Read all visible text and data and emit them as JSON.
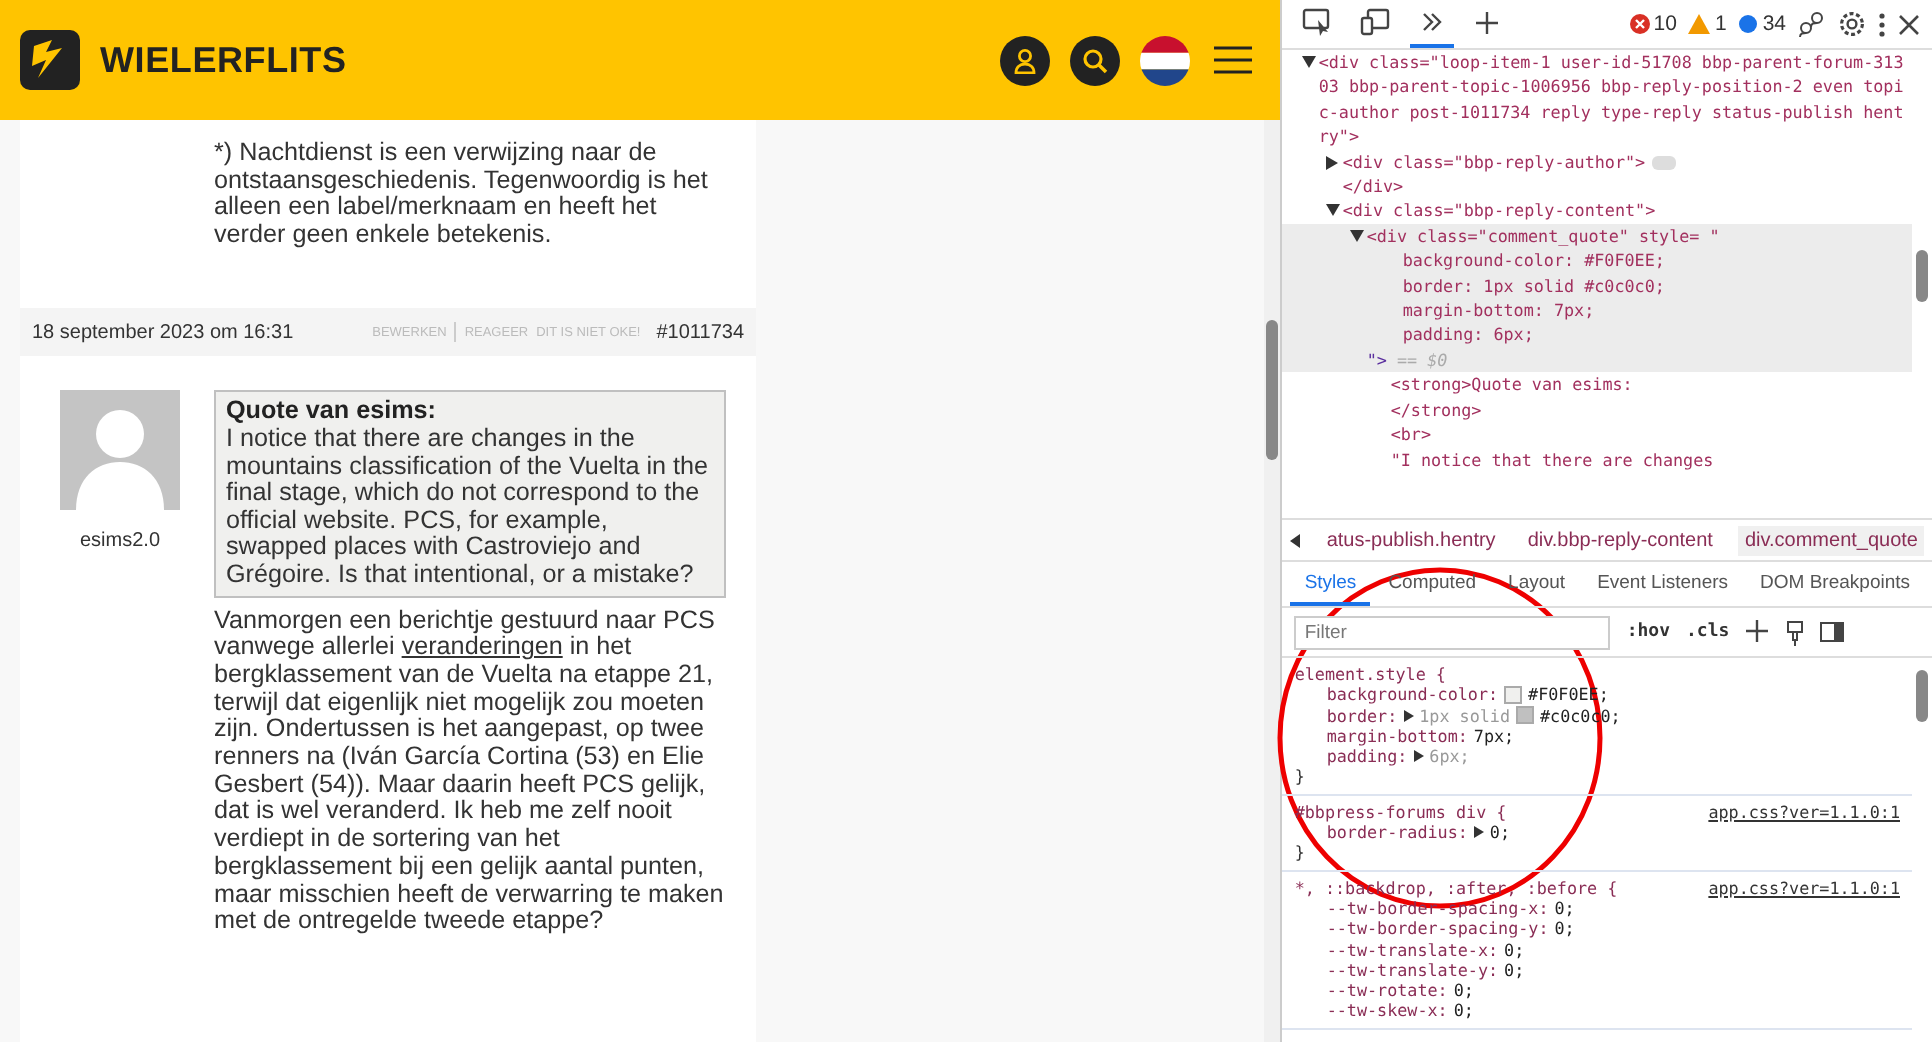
{
  "site_header": {
    "logo_text": "WIELERFLITS"
  },
  "thread": {
    "previous_post_text": "*) Nachtdienst is een verwijzing naar de ontstaansgeschiedenis. Tegenwoordig is het alleen een label/merknaam en heeft het verder geen enkele betekenis.",
    "reply": {
      "date": "18 september 2023 om 16:31",
      "actions": [
        "BEWERKEN",
        "REAGEER",
        "DIT IS NIET OKE!"
      ],
      "post_number": "#1011734",
      "author": "esims2.0",
      "quote": {
        "title": "Quote van esims:",
        "text": "I notice that there are changes in the mountains classification of the Vuelta in the final stage, which do not correspond to the official website. PCS, for example, swapped places with Castroviejo and Grégoire. Is that intentional, or a mistake?"
      },
      "body": [
        {
          "kind": "plain",
          "text": "Vanmorgen een berichtje gestuurd naar PCS vanwege allerlei "
        },
        {
          "kind": "link",
          "text": "veranderingen"
        },
        {
          "kind": "plain",
          "text": " in het bergklassement van de Vuelta na etappe 21, terwijl dat eigenlijk niet mogelijk zou moeten zijn. Ondertussen is het aangepast, op twee renners na (Iván García Cortina (53) en Elie Gesbert (54)). Maar daarin heeft PCS gelijk, dat is wel veranderd. Ik heb me zelf nooit verdiept in de sortering van het bergklassement bij een gelijk aantal punten, maar misschien heeft de verwarring te maken met de ontregelde tweede etappe?"
        }
      ]
    }
  },
  "devtools": {
    "toolbar": {
      "tabs": [
        {
          "kind": "inspect",
          "selected": false
        },
        {
          "kind": "device",
          "selected": false
        },
        {
          "kind": "more",
          "selected": true
        },
        {
          "kind": "add",
          "selected": false
        }
      ],
      "errors": "10",
      "warnings": "1",
      "messages": "34"
    },
    "dom_tree": [
      {
        "expanded": true,
        "selected": false,
        "markup": "<div class=\"loop-item-1 user-id-51708 bbp-parent-forum-31303 bbp-parent-topic-1006956 bbp-reply-position-2 even topic-author  post-1011734 reply type-reply status-publish hentry\">",
        "children": [
          {
            "expanded": false,
            "selected": false,
            "ellipsis": true,
            "markup": "<div class=\"bbp-reply-author\">",
            "closing": "</div>"
          },
          {
            "expanded": true,
            "selected": false,
            "markup": "<div class=\"bbp-reply-content\">",
            "children": [
              {
                "expanded": true,
                "selected": true,
                "markup": "<div class=\"comment_quote\" style= \"",
                "style_lines": [
                  "background-color: #F0F0EE;",
                  "border: 1px solid #c0c0c0;",
                  "margin-bottom: 7px;",
                  "padding: 6px;"
                ],
                "tail": "\">",
                "marker": "== $0",
                "children": [
                  {
                    "selected": false,
                    "markup": "<strong>Quote van esims:"
                  },
                  {
                    "selected": false,
                    "markup": "</strong>"
                  },
                  {
                    "selected": false,
                    "markup": "<br>"
                  },
                  {
                    "selected": false,
                    "markup": "\"I notice that there are changes"
                  }
                ]
              }
            ]
          }
        ]
      }
    ],
    "breadcrumbs": [
      {
        "label": "atus-publish.hentry",
        "selected": false
      },
      {
        "label": "div.bbp-reply-content",
        "selected": false
      },
      {
        "label": "div.comment_quote",
        "selected": true
      }
    ],
    "panel_tabs": [
      {
        "label": "Styles",
        "selected": true
      },
      {
        "label": "Computed",
        "selected": false
      },
      {
        "label": "Layout",
        "selected": false
      },
      {
        "label": "Event Listeners",
        "selected": false
      },
      {
        "label": "DOM Breakpoints",
        "selected": false
      }
    ],
    "filter": {
      "placeholder": "Filter"
    },
    "style_buttons": [
      ":hov",
      ".cls"
    ],
    "rules": [
      {
        "selector": "element.style {",
        "close": "}",
        "props": [
          {
            "name": "background-color:",
            "expandable": false,
            "dimmed": false,
            "color": "#f0f0ee",
            "value": "#F0F0EE;"
          },
          {
            "name": "border:",
            "expandable": true,
            "dimmed": true,
            "value": "1px solid",
            "color": "#c0c0c0",
            "color_value": "#c0c0c0;"
          },
          {
            "name": "margin-bottom:",
            "expandable": false,
            "dimmed": false,
            "value": "7px;"
          },
          {
            "name": "padding:",
            "expandable": true,
            "dimmed": true,
            "value": "6px;"
          }
        ]
      },
      {
        "selector": "#bbpress-forums div {",
        "source": "app.css?ver=1.1.0:1",
        "close": "}",
        "props": [
          {
            "name": "border-radius:",
            "expandable": true,
            "dimmed": false,
            "value": "0;"
          }
        ]
      },
      {
        "selector": "*, ::backdrop, :after, :before {",
        "source": "app.css?ver=1.1.0:1",
        "props": [
          {
            "name": "--tw-border-spacing-x:",
            "expandable": false,
            "dimmed": false,
            "value": "0;"
          },
          {
            "name": "--tw-border-spacing-y:",
            "expandable": false,
            "dimmed": false,
            "value": "0;"
          },
          {
            "name": "--tw-translate-x:",
            "expandable": false,
            "dimmed": false,
            "value": "0;"
          },
          {
            "name": "--tw-translate-y:",
            "expandable": false,
            "dimmed": false,
            "value": "0;"
          },
          {
            "name": "--tw-rotate:",
            "expandable": false,
            "dimmed": false,
            "value": "0;"
          },
          {
            "name": "--tw-skew-x:",
            "expandable": false,
            "dimmed": false,
            "value": "0;"
          }
        ]
      }
    ]
  }
}
